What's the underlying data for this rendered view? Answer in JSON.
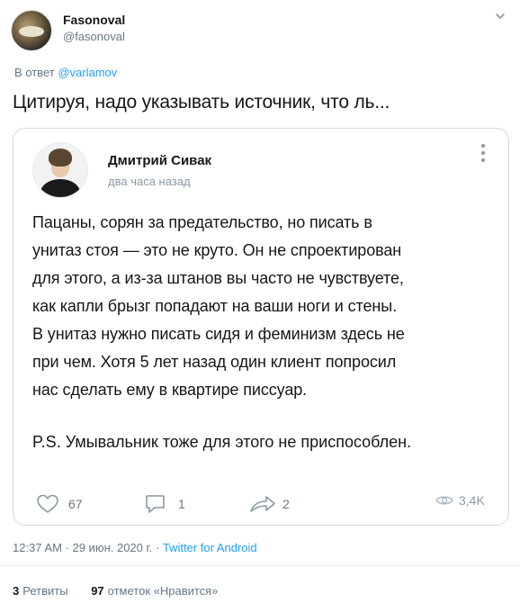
{
  "tweet": {
    "author_name": "Fasonoval",
    "author_handle": "@fasonoval",
    "reply_prefix": "В ответ",
    "reply_to": "@varlamov",
    "text": "Цитируя, надо указывать источник, что ль...",
    "timestamp": "12:37 AM · 29 июн. 2020 г. · ",
    "source": "Twitter for Android",
    "retweets_count": "3",
    "retweets_label": "Ретвиты",
    "likes_count": "97",
    "likes_label": "отметок «Нравится»"
  },
  "quoted": {
    "author_name": "Дмитрий Сивак",
    "time_ago": "два часа назад",
    "lines": [
      "Пацаны, сорян за предательство, но писать в",
      "унитаз стоя — это не круто. Он не спроектирован",
      "для этого, а из-за штанов вы часто не чувствуете,",
      "как капли брызг попадают на ваши ноги и стены.",
      "В унитаз нужно писать сидя и феминизм здесь не",
      "при чем. Хотя 5 лет назад один клиент попросил",
      "нас сделать ему в квартире писсуар."
    ],
    "ps": "P.S. Умывальник тоже для этого не приспособлен.",
    "likes": "67",
    "comments": "1",
    "shares": "2",
    "views": "3,4K"
  },
  "colors": {
    "link": "#1da1f2",
    "secondary_text": "#657786",
    "border": "#cfd9de"
  }
}
